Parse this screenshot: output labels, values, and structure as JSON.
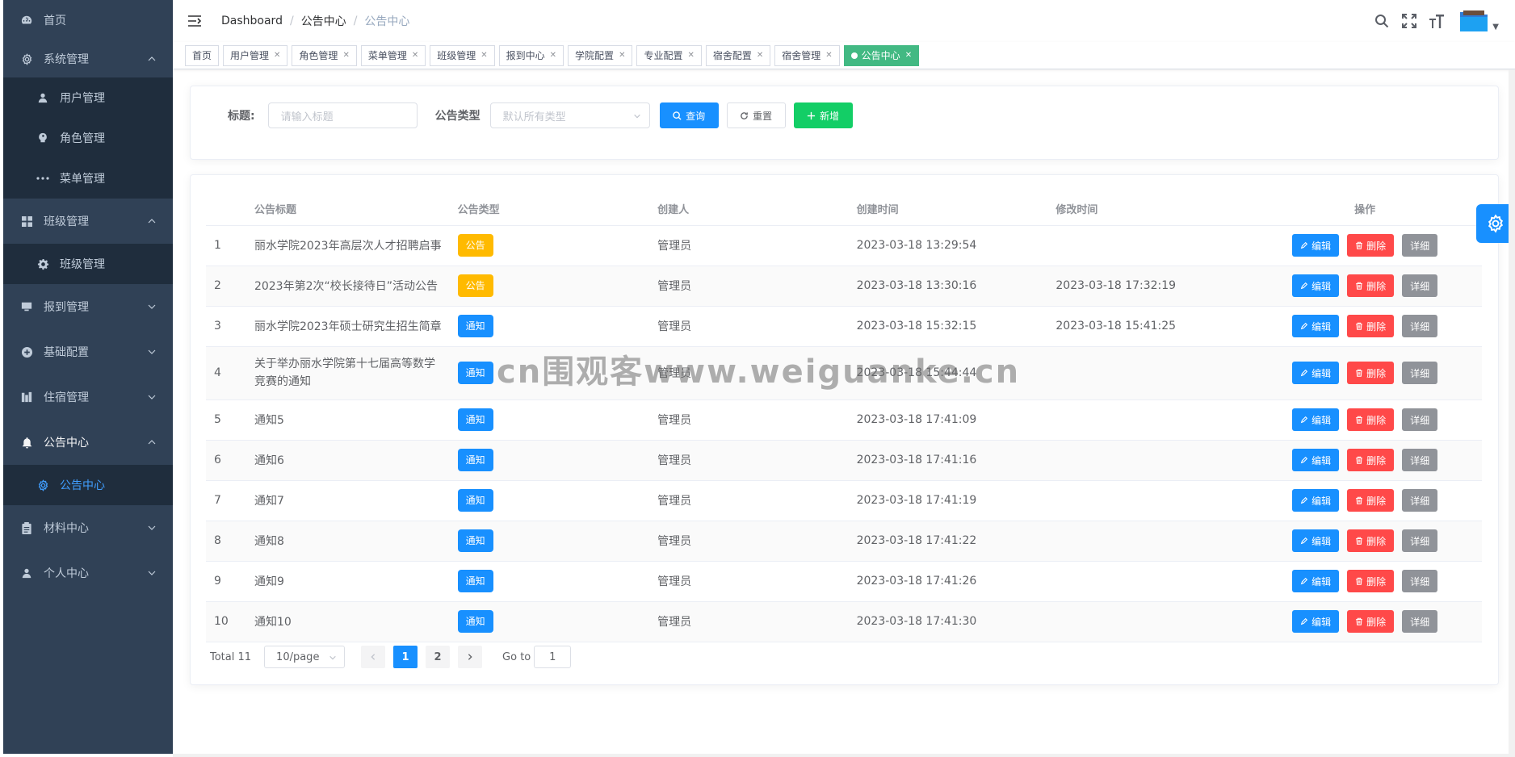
{
  "sidebar": {
    "items": [
      {
        "label": "首页",
        "icon": "dashboard-icon"
      },
      {
        "label": "系统管理",
        "icon": "gear-icon",
        "expanded": true,
        "children": [
          {
            "label": "用户管理",
            "icon": "user-icon"
          },
          {
            "label": "角色管理",
            "icon": "peoples-icon"
          },
          {
            "label": "菜单管理",
            "icon": "more-icon"
          }
        ]
      },
      {
        "label": "班级管理",
        "icon": "grid-icon",
        "expanded": true,
        "children": [
          {
            "label": "班级管理",
            "icon": "cog-icon"
          }
        ]
      },
      {
        "label": "报到管理",
        "icon": "monitor-icon",
        "expanded": false
      },
      {
        "label": "基础配置",
        "icon": "plus-circle-icon",
        "expanded": false
      },
      {
        "label": "住宿管理",
        "icon": "building-icon",
        "expanded": false
      },
      {
        "label": "公告中心",
        "icon": "bell-icon",
        "expanded": true,
        "children": [
          {
            "label": "公告中心",
            "icon": "setting-icon",
            "active": true
          }
        ]
      },
      {
        "label": "材料中心",
        "icon": "clipboard-icon",
        "expanded": false
      },
      {
        "label": "个人中心",
        "icon": "user-icon",
        "expanded": false
      }
    ]
  },
  "header": {
    "breadcrumb": [
      "Dashboard",
      "公告中心",
      "公告中心"
    ]
  },
  "tags": [
    {
      "label": "首页",
      "closable": false
    },
    {
      "label": "用户管理",
      "closable": true
    },
    {
      "label": "角色管理",
      "closable": true
    },
    {
      "label": "菜单管理",
      "closable": true
    },
    {
      "label": "班级管理",
      "closable": true
    },
    {
      "label": "报到中心",
      "closable": true
    },
    {
      "label": "学院配置",
      "closable": true
    },
    {
      "label": "专业配置",
      "closable": true
    },
    {
      "label": "宿舍配置",
      "closable": true
    },
    {
      "label": "宿舍管理",
      "closable": true
    },
    {
      "label": "公告中心",
      "closable": true,
      "active": true
    }
  ],
  "search": {
    "title_label": "标题:",
    "title_placeholder": "请输入标题",
    "type_label": "公告类型",
    "type_placeholder": "默认所有类型",
    "query_btn": "查询",
    "reset_btn": "重置",
    "add_btn": "新增"
  },
  "table": {
    "columns": [
      "",
      "公告标题",
      "公告类型",
      "创建人",
      "创建时间",
      "修改时间",
      "操作"
    ],
    "rows": [
      {
        "idx": "1",
        "title": "丽水学院2023年高层次人才招聘启事",
        "type": "公告",
        "creator": "管理员",
        "created": "2023-03-18 13:29:54",
        "modified": ""
      },
      {
        "idx": "2",
        "title": "2023年第2次“校长接待日”活动公告",
        "type": "公告",
        "creator": "管理员",
        "created": "2023-03-18 13:30:16",
        "modified": "2023-03-18 17:32:19"
      },
      {
        "idx": "3",
        "title": "丽水学院2023年硕士研究生招生简章",
        "type": "通知",
        "creator": "管理员",
        "created": "2023-03-18 15:32:15",
        "modified": "2023-03-18 15:41:25"
      },
      {
        "idx": "4",
        "title": "关于举办丽水学院第十七届高等数学",
        "title2": "竞赛的通知",
        "type": "通知",
        "creator": "管理员",
        "created": "2023-03-18 15:44:44",
        "modified": ""
      },
      {
        "idx": "5",
        "title": "通知5",
        "type": "通知",
        "creator": "管理员",
        "created": "2023-03-18 17:41:09",
        "modified": ""
      },
      {
        "idx": "6",
        "title": "通知6",
        "type": "通知",
        "creator": "管理员",
        "created": "2023-03-18 17:41:16",
        "modified": ""
      },
      {
        "idx": "7",
        "title": "通知7",
        "type": "通知",
        "creator": "管理员",
        "created": "2023-03-18 17:41:19",
        "modified": ""
      },
      {
        "idx": "8",
        "title": "通知8",
        "type": "通知",
        "creator": "管理员",
        "created": "2023-03-18 17:41:22",
        "modified": ""
      },
      {
        "idx": "9",
        "title": "通知9",
        "type": "通知",
        "creator": "管理员",
        "created": "2023-03-18 17:41:26",
        "modified": ""
      },
      {
        "idx": "10",
        "title": "通知10",
        "type": "通知",
        "creator": "管理员",
        "created": "2023-03-18 17:41:30",
        "modified": ""
      }
    ],
    "ops": {
      "edit": "编辑",
      "delete": "删除",
      "detail": "详细"
    }
  },
  "pagination": {
    "total": "Total 11",
    "page_size": "10/page",
    "pages": [
      "1",
      "2"
    ],
    "current": "1",
    "goto_label": "Go to",
    "goto_value": "1"
  },
  "watermark": "cn围观客www.weiguanke.cn",
  "colors": {
    "sidebar_bg": "#304156",
    "submenu_bg": "#1f2d3d",
    "primary": "#1890ff",
    "success": "#13ce66",
    "danger": "#ff4949",
    "info": "#909399",
    "warning_tag": "#ffba00",
    "active_tag": "#42b983"
  }
}
